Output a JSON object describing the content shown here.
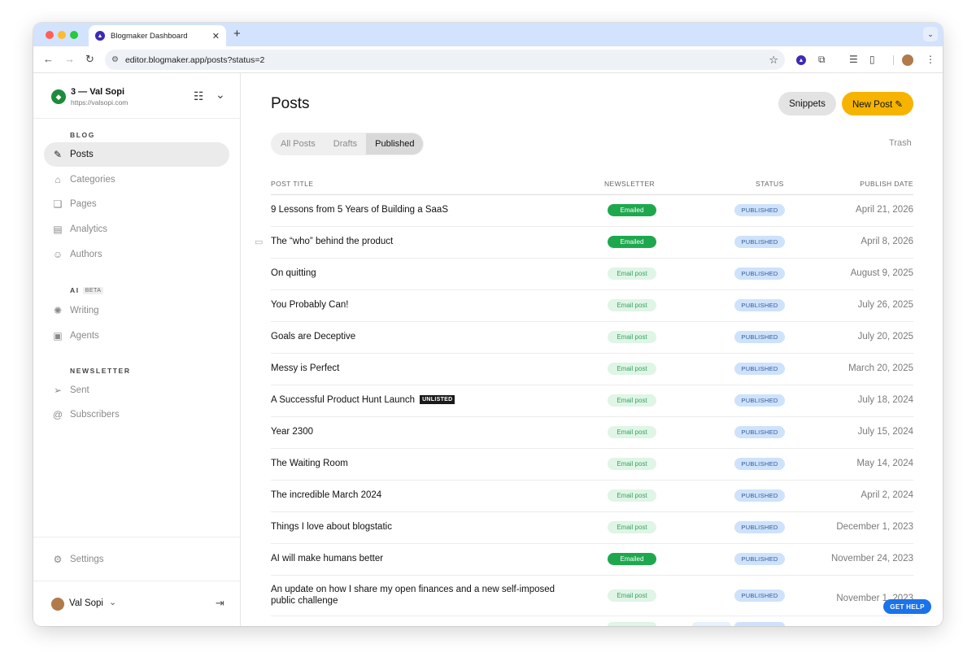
{
  "browser": {
    "tab_title": "Blogmaker Dashboard",
    "url": "editor.blogmaker.app/posts?status=2",
    "new_tab": "+",
    "tab_close": "✕"
  },
  "sidebar": {
    "site_name": "3 — Val Sopi",
    "site_url": "https://valsopi.com",
    "sections": {
      "blog": "BLOG",
      "ai": "AI",
      "ai_badge": "BETA",
      "newsletter": "NEWSLETTER"
    },
    "items": [
      {
        "label": "Posts",
        "icon": "pencil-square-icon"
      },
      {
        "label": "Categories",
        "icon": "tag-icon"
      },
      {
        "label": "Pages",
        "icon": "pages-icon"
      },
      {
        "label": "Analytics",
        "icon": "chart-icon"
      },
      {
        "label": "Authors",
        "icon": "users-icon"
      },
      {
        "label": "Writing",
        "icon": "sparkle-icon"
      },
      {
        "label": "Agents",
        "icon": "chip-icon"
      },
      {
        "label": "Sent",
        "icon": "send-icon"
      },
      {
        "label": "Subscribers",
        "icon": "at-icon"
      }
    ],
    "settings": "Settings",
    "user_name": "Val Sopi"
  },
  "main": {
    "title": "Posts",
    "snippets_label": "Snippets",
    "new_post_label": "New Post",
    "tabs": [
      "All Posts",
      "Drafts",
      "Published"
    ],
    "trash": "Trash",
    "columns": {
      "title": "POST TITLE",
      "newsletter": "NEWSLETTER",
      "status": "STATUS",
      "date": "PUBLISH DATE"
    },
    "rows": [
      {
        "title": "9 Lessons from 5 Years of Building a SaaS",
        "newsletter": "Emailed",
        "status": "PUBLISHED",
        "date": "April 21, 2026"
      },
      {
        "title": "The “who” behind the product",
        "newsletter": "Emailed",
        "status": "PUBLISHED",
        "date": "April 8, 2026"
      },
      {
        "title": "On quitting",
        "newsletter": "Email post",
        "status": "PUBLISHED",
        "date": "August 9, 2025"
      },
      {
        "title": "You Probably Can!",
        "newsletter": "Email post",
        "status": "PUBLISHED",
        "date": "July 26, 2025"
      },
      {
        "title": "Goals are Deceptive",
        "newsletter": "Email post",
        "status": "PUBLISHED",
        "date": "July 20, 2025"
      },
      {
        "title": "Messy is Perfect",
        "newsletter": "Email post",
        "status": "PUBLISHED",
        "date": "March 20, 2025"
      },
      {
        "title": "A Successful Product Hunt Launch",
        "badge": "UNLISTED",
        "newsletter": "Email post",
        "status": "PUBLISHED",
        "date": "July 18, 2024"
      },
      {
        "title": "Year 2300",
        "newsletter": "Email post",
        "status": "PUBLISHED",
        "date": "July 15, 2024"
      },
      {
        "title": "The Waiting Room",
        "newsletter": "Email post",
        "status": "PUBLISHED",
        "date": "May 14, 2024"
      },
      {
        "title": "The incredible March 2024",
        "newsletter": "Email post",
        "status": "PUBLISHED",
        "date": "April 2, 2024"
      },
      {
        "title": "Things I love about blogstatic",
        "newsletter": "Email post",
        "status": "PUBLISHED",
        "date": "December 1, 2023"
      },
      {
        "title": "AI will make humans better",
        "newsletter": "Emailed",
        "status": "PUBLISHED",
        "date": "November 24, 2023"
      },
      {
        "title": "An update on how I share my open finances and a new self-imposed public challenge",
        "newsletter": "Email post",
        "status": "PUBLISHED",
        "date": "November 1, 2023"
      }
    ]
  },
  "get_help": "GET HELP",
  "colors": {
    "accent": "#f6b400",
    "emailed": "#1ea84e",
    "published": "#cfe2fb",
    "help": "#1a73e8"
  }
}
